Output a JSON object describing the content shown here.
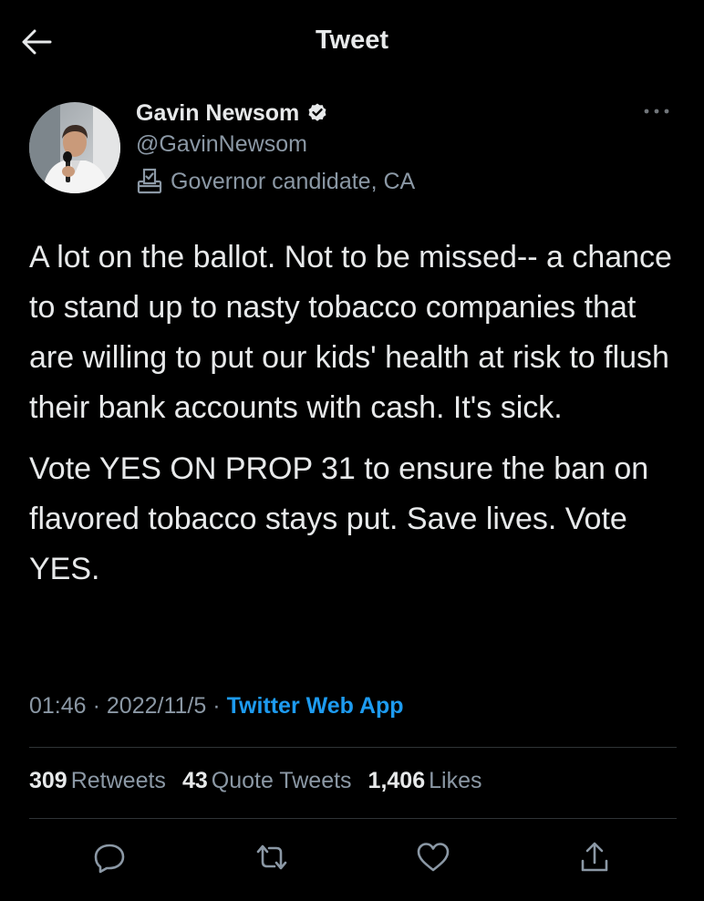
{
  "header": {
    "title": "Tweet",
    "back_icon": "arrow-left-icon"
  },
  "author": {
    "name": "Gavin Newsom",
    "handle": "@GavinNewsom",
    "label": "Governor candidate, CA",
    "verified": true
  },
  "tweet": {
    "paragraphs": [
      "A lot on the ballot. Not to be missed-- a chance to stand up to nasty tobacco companies that are willing to put our kids' health at risk to flush their bank accounts with cash. It's sick.",
      "Vote YES ON PROP 31 to ensure the ban on flavored tobacco stays put. Save lives. Vote YES."
    ],
    "time": "01:46",
    "date": "2022/11/5",
    "separator": "·",
    "source": "Twitter Web App"
  },
  "stats": {
    "retweets_count": "309",
    "retweets_label": "Retweets",
    "quotes_count": "43",
    "quotes_label": "Quote Tweets",
    "likes_count": "1,406",
    "likes_label": "Likes"
  },
  "actions": [
    "reply-icon",
    "retweet-icon",
    "like-icon",
    "share-icon"
  ],
  "colors": {
    "background": "#000000",
    "text": "#e7e9ea",
    "secondary": "#8b98a5",
    "accent": "#1d9bf0",
    "divider": "#2f3336"
  }
}
